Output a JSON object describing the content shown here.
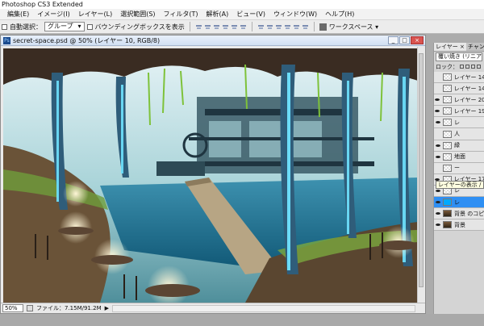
{
  "app": {
    "title": "Photoshop CS3 Extended"
  },
  "menu": [
    "編集(E)",
    "イメージ(I)",
    "レイヤー(L)",
    "選択範囲(S)",
    "フィルタ(T)",
    "解析(A)",
    "ビュー(V)",
    "ウィンドウ(W)",
    "ヘルプ(H)"
  ],
  "options": {
    "auto_select_label": "自動選択：",
    "auto_select_value": "グループ",
    "bounding_box_label": "バウンディングボックスを表示",
    "workspace_label": "ワークスペース ▾"
  },
  "document": {
    "title": "secret-space.psd @ 50% (レイヤー 10, RGB/8)",
    "zoom": "50%",
    "file_info": "ファイル：7.15M/91.2M"
  },
  "layers_panel": {
    "tabs": [
      "レイヤー ×",
      "チャンネル"
    ],
    "blend_mode": "覆い焼き (リニア...",
    "lock_label": "ロック：",
    "tooltip": "レイヤーの表示 / 非表示",
    "layers": [
      {
        "name": "レイヤー 14",
        "visible": false,
        "thumb": "check",
        "selected": false
      },
      {
        "name": "レイヤー 14",
        "visible": false,
        "thumb": "check",
        "selected": false
      },
      {
        "name": "レイヤー 20",
        "visible": true,
        "thumb": "check",
        "selected": false
      },
      {
        "name": "レイヤー 19",
        "visible": true,
        "thumb": "check",
        "selected": false
      },
      {
        "name": "レ",
        "visible": true,
        "thumb": "check",
        "selected": false
      },
      {
        "name": "人",
        "visible": false,
        "thumb": "check",
        "selected": false
      },
      {
        "name": "緑",
        "visible": true,
        "thumb": "check",
        "selected": false
      },
      {
        "name": "地面",
        "visible": true,
        "thumb": "check",
        "selected": false
      },
      {
        "name": "ー",
        "visible": false,
        "thumb": "check",
        "selected": false
      },
      {
        "name": "レイヤー 17",
        "visible": true,
        "thumb": "check",
        "selected": false
      },
      {
        "name": "レ",
        "visible": true,
        "thumb": "check",
        "selected": false
      },
      {
        "name": "レ",
        "visible": true,
        "thumb": "cyan",
        "selected": true
      },
      {
        "name": "背景 のコピ",
        "visible": true,
        "thumb": "scene",
        "selected": false
      },
      {
        "name": "背景",
        "visible": true,
        "thumb": "scene",
        "selected": false
      }
    ]
  }
}
